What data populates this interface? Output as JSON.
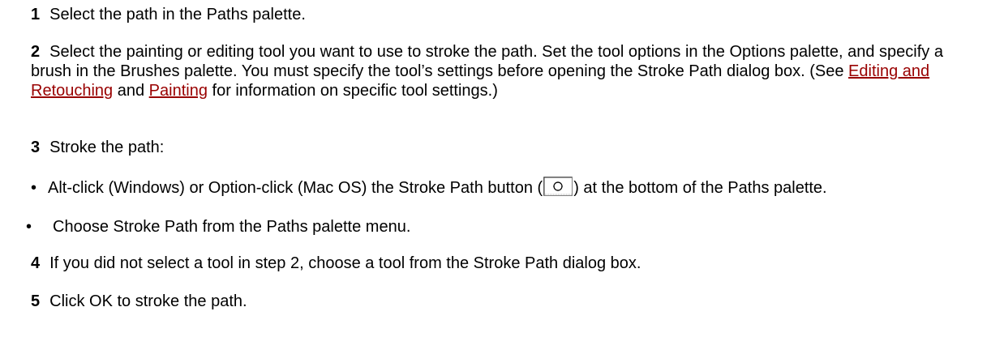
{
  "steps": [
    {
      "num": "1",
      "text": "Select the path in the Paths palette."
    },
    {
      "num": "2",
      "text_before": "Select the painting or editing tool you want to use to stroke the path. Set the tool options in the Options palette, and specify a brush in the Brushes palette. You must specify the tool’s settings before opening the Stroke Path dialog box. (See ",
      "link1": "Editing and Retouching",
      "text_mid": " and ",
      "link2": "Painting",
      "text_after": " for information on specific tool settings.)"
    },
    {
      "num": "3",
      "text": "Stroke the path:"
    },
    {
      "num": "4",
      "text": "If you did not select a tool in step 2, choose a tool from the Stroke Path dialog box."
    },
    {
      "num": "5",
      "text": "Click OK to stroke the path."
    }
  ],
  "bullets": [
    {
      "marker": "•",
      "text_before": "Alt-click (Windows) or Option-click (Mac OS) the Stroke Path button (",
      "icon": "stroke-path-button-icon",
      "text_after": ") at the bottom of the Paths palette."
    },
    {
      "marker": "•",
      "text": "Choose Stroke Path from the Paths palette menu."
    }
  ],
  "colors": {
    "link": "#990000",
    "text": "#000000",
    "background": "#ffffff"
  }
}
